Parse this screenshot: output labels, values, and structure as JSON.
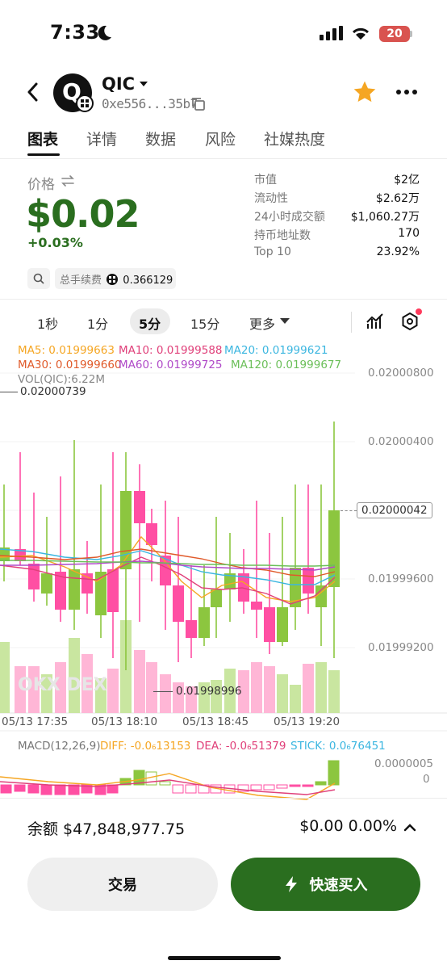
{
  "status": {
    "time": "7:33",
    "battery": "20"
  },
  "header": {
    "name": "QIC",
    "address": "0xe556...35b7",
    "logo_text": "Q"
  },
  "tabs": [
    "图表",
    "详情",
    "数据",
    "风险",
    "社媒热度"
  ],
  "price": {
    "label": "价格",
    "value": "$0.02",
    "change": "+0.03%"
  },
  "stats": [
    {
      "label": "市值",
      "value": "$2亿"
    },
    {
      "label": "流动性",
      "value": "$2.62万"
    },
    {
      "label": "24小时成交额",
      "value": "$1,060.27万"
    },
    {
      "label": "持币地址数",
      "value": "170"
    },
    {
      "label": "Top 10",
      "value": "23.92%"
    }
  ],
  "fee": {
    "label": "总手续费",
    "value": "0.366129"
  },
  "timeframes": [
    "1秒",
    "1分",
    "5分",
    "15分",
    "更多"
  ],
  "timeframe_active": "5分",
  "indicators": {
    "ma5": "MA5: 0.01999663",
    "ma10": "MA10: 0.01999588",
    "ma20": "MA20: 0.01999621",
    "ma30": "MA30: 0.01999660",
    "ma60": "MA60: 0.01999725",
    "ma120": "MA120: 0.01999677",
    "vol": "VOL(QIC):6.22M"
  },
  "colors": {
    "up": "#8cc63f",
    "down": "#ff4fa3",
    "ma5": "#f5a623",
    "ma10": "#e0407a",
    "ma20": "#3bb6e0",
    "ma30": "#e05a2a",
    "ma60": "#b04ac8",
    "ma120": "#6bbf59",
    "brand_green": "#2a6e1f"
  },
  "chart_data": {
    "type": "candlestick",
    "y_ticks": [
      "0.02000800",
      "0.02000400",
      "0.01999600",
      "0.01999200"
    ],
    "x_ticks": [
      "05/13 17:35",
      "05/13 18:10",
      "05/13 18:45",
      "05/13 19:20"
    ],
    "high_marker": "0.02000739",
    "low_marker": "0.01998996",
    "current_price": "0.02000042",
    "watermark": "OKX DEX"
  },
  "macd": {
    "title": "MACD(12,26,9)",
    "diff": "DIFF: -0.0₆13153",
    "dea": "DEA: -0.0₆51379",
    "stick": "STICK: 0.0₆76451",
    "y_ticks": [
      "0.0000005",
      "0"
    ]
  },
  "footer": {
    "balance": "余额 $47,848,977.75",
    "pnl": "$0.00 0.00%",
    "trade_label": "交易",
    "buy_label": "快速买入"
  }
}
